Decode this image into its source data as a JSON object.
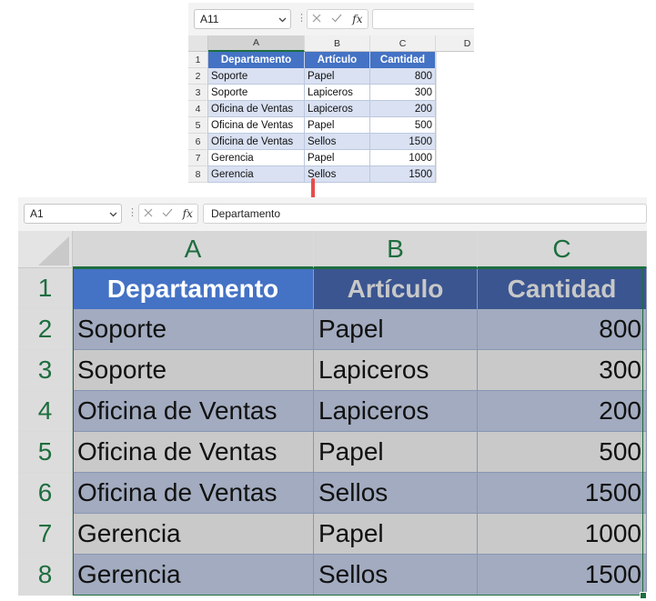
{
  "small": {
    "name_box": "A11",
    "formula": "",
    "fx_label": "fx",
    "columns": [
      "A",
      "B",
      "C",
      "D"
    ],
    "rows": [
      "1",
      "2",
      "3",
      "4",
      "5",
      "6",
      "7",
      "8"
    ],
    "header": [
      "Departamento",
      "Artículo",
      "Cantidad"
    ],
    "data": [
      [
        "Soporte",
        "Papel",
        "800"
      ],
      [
        "Soporte",
        "Lapiceros",
        "300"
      ],
      [
        "Oficina de Ventas",
        "Lapiceros",
        "200"
      ],
      [
        "Oficina de Ventas",
        "Papel",
        "500"
      ],
      [
        "Oficina de Ventas",
        "Sellos",
        "1500"
      ],
      [
        "Gerencia",
        "Papel",
        "1000"
      ],
      [
        "Gerencia",
        "Sellos",
        "1500"
      ]
    ]
  },
  "large": {
    "name_box": "A1",
    "formula": "Departamento",
    "fx_label": "fx",
    "columns": [
      "A",
      "B",
      "C"
    ],
    "rows": [
      "1",
      "2",
      "3",
      "4",
      "5",
      "6",
      "7",
      "8"
    ],
    "header": [
      "Departamento",
      "Artículo",
      "Cantidad"
    ],
    "data": [
      [
        "Soporte",
        "Papel",
        "800"
      ],
      [
        "Soporte",
        "Lapiceros",
        "300"
      ],
      [
        "Oficina de Ventas",
        "Lapiceros",
        "200"
      ],
      [
        "Oficina de Ventas",
        "Papel",
        "500"
      ],
      [
        "Oficina de Ventas",
        "Sellos",
        "1500"
      ],
      [
        "Gerencia",
        "Papel",
        "1000"
      ],
      [
        "Gerencia",
        "Sellos",
        "1500"
      ]
    ]
  },
  "colors": {
    "table_header_blue": "#4472c4",
    "table_band_light": "#d9e1f2",
    "large_header_a": "#4472c4",
    "large_header_bc": "#3a5590",
    "large_header_bc_text": "#c8c8c8",
    "large_band_dark": "#a2abbf",
    "large_band_light": "#c9c9c9",
    "selection_green": "#1e6e3f",
    "arrow_red": "#e74c4c"
  },
  "icons": {
    "cancel": "x-icon",
    "enter": "check-icon",
    "chevron": "chevron-down-icon",
    "arrow": "arrow-down-icon"
  }
}
